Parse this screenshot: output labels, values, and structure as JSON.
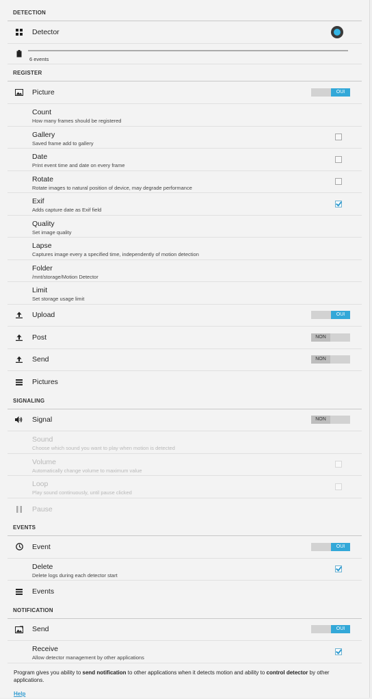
{
  "detection": {
    "header": "DETECTION",
    "detector": {
      "title": "Detector",
      "icon": "grid-icon",
      "enabled": true
    },
    "events_count": {
      "icon": "battery-icon",
      "label": "6 events"
    }
  },
  "register": {
    "header": "REGISTER",
    "picture": {
      "title": "Picture",
      "icon": "image-icon",
      "toggle": "OUI"
    },
    "count": {
      "title": "Count",
      "summary": "How many frames should be registered"
    },
    "gallery": {
      "title": "Gallery",
      "summary": "Saved frame add to gallery",
      "checked": false
    },
    "date": {
      "title": "Date",
      "summary": "Print event time and date on every frame",
      "checked": false
    },
    "rotate": {
      "title": "Rotate",
      "summary": "Rotate images to natural position of device, may degrade performance",
      "checked": false
    },
    "exif": {
      "title": "Exif",
      "summary": "Adds capture date as Exif field",
      "checked": true
    },
    "quality": {
      "title": "Quality",
      "summary": "Set image quality"
    },
    "lapse": {
      "title": "Lapse",
      "summary": "Captures image every a specified time, independently of motion detection"
    },
    "folder": {
      "title": "Folder",
      "summary": "/mnt/storage/Motion Detector"
    },
    "limit": {
      "title": "Limit",
      "summary": "Set storage usage limit"
    },
    "upload": {
      "title": "Upload",
      "icon": "upload-icon",
      "toggle": "OUI"
    },
    "post": {
      "title": "Post",
      "icon": "upload-icon",
      "toggle": "NON"
    },
    "send": {
      "title": "Send",
      "icon": "upload-icon",
      "toggle": "NON"
    },
    "pictures": {
      "title": "Pictures",
      "icon": "list-icon"
    }
  },
  "signaling": {
    "header": "SIGNALING",
    "signal": {
      "title": "Signal",
      "icon": "speaker-icon",
      "toggle": "NON"
    },
    "sound": {
      "title": "Sound",
      "summary": "Choose which sound you want to play when motion is detected"
    },
    "volume": {
      "title": "Volume",
      "summary": "Automatically change volume to maximum value",
      "checked": false
    },
    "loop": {
      "title": "Loop",
      "summary": "Play sound continuously, until pause clicked",
      "checked": false
    },
    "pause": {
      "title": "Pause",
      "icon": "pause-icon"
    }
  },
  "events": {
    "header": "EVENTS",
    "event": {
      "title": "Event",
      "icon": "clock-icon",
      "toggle": "OUI"
    },
    "delete": {
      "title": "Delete",
      "summary": "Delete logs during each detector start",
      "checked": true
    },
    "events_list": {
      "title": "Events",
      "icon": "list-icon"
    }
  },
  "notification": {
    "header": "NOTIFICATION",
    "send": {
      "title": "Send",
      "icon": "image-send-icon",
      "toggle": "OUI"
    },
    "receive": {
      "title": "Receive",
      "summary": "Allow detector management by other applications",
      "checked": true
    }
  },
  "footer": {
    "text_1": "Program gives you ability to ",
    "bold_1": "send notification",
    "text_2": " to other applications when it detects motion and ability to ",
    "bold_2": "control detector",
    "text_3": " by other applications.",
    "help": "Help"
  },
  "colors": {
    "accent": "#33a8d8",
    "toggle_off": "#bdbdbd",
    "background": "#f3f3f3"
  }
}
